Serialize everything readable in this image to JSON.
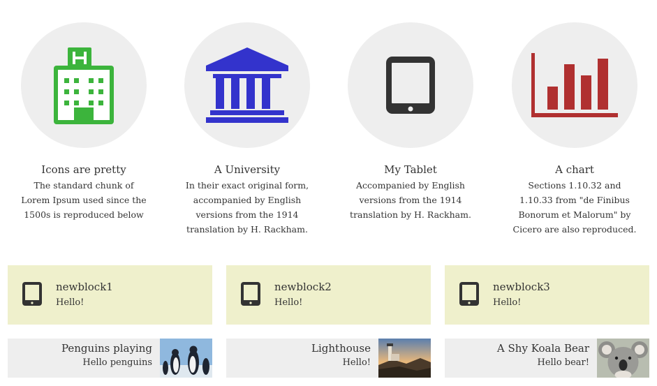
{
  "features": [
    {
      "icon": "hospital-icon",
      "title": "Icons are pretty",
      "text": "The standard chunk of Lorem Ipsum used since the 1500s is reproduced below",
      "color": "#3cb43c"
    },
    {
      "icon": "university-icon",
      "title": "A University",
      "text": "In their exact original form, accompanied by English versions from the 1914 translation by H. Rackham.",
      "color": "#3333cc"
    },
    {
      "icon": "tablet-icon",
      "title": "My Tablet",
      "text": "Accompanied by English versions from the 1914 translation by H. Rackham.",
      "color": "#333333"
    },
    {
      "icon": "bar-chart-icon",
      "title": "A chart",
      "text": "Sections 1.10.32 and 1.10.33 from \"de Finibus Bonorum et Malorum\" by Cicero are also reproduced.",
      "color": "#b03030"
    }
  ],
  "newblocks": [
    {
      "title": "newblock1",
      "subtitle": "Hello!"
    },
    {
      "title": "newblock2",
      "subtitle": "Hello!"
    },
    {
      "title": "newblock3",
      "subtitle": "Hello!"
    }
  ],
  "photoblocks": [
    {
      "title": "Penguins playing",
      "subtitle": "Hello penguins",
      "image": "penguins-photo"
    },
    {
      "title": "Lighthouse",
      "subtitle": "Hello!",
      "image": "lighthouse-photo"
    },
    {
      "title": "A Shy Koala Bear",
      "subtitle": "Hello bear!",
      "image": "koala-photo"
    }
  ],
  "colors": {
    "newblock_bg": "#eff0cc",
    "photoblock_bg": "#eeeeee",
    "circle_bg": "#eeeeee"
  }
}
